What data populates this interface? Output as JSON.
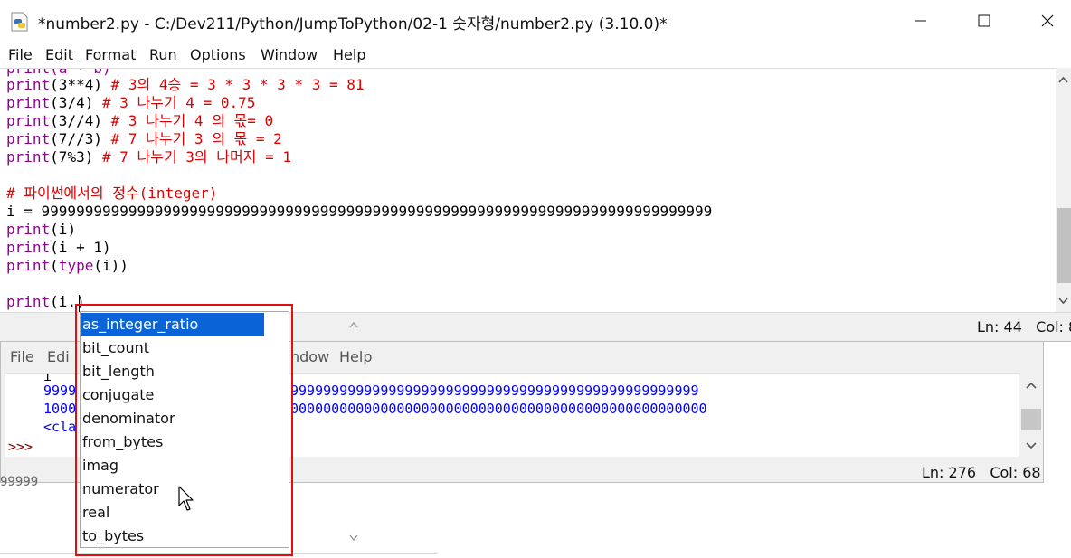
{
  "editor": {
    "title": "*number2.py - C:/Dev211/Python/JumpToPython/02-1 숫자형/number2.py (3.10.0)*",
    "menu": [
      "File",
      "Edit",
      "Format",
      "Run",
      "Options",
      "Window",
      "Help"
    ],
    "code": {
      "partial_top": "print(a * b)",
      "line1_call": "print",
      "line1_args": "(3**4)",
      "line1_comment": " # 3의 4승 = 3 * 3 * 3 * 3 = 81",
      "line2_call": "print",
      "line2_args": "(3/4)",
      "line2_comment": " # 3 나누기 4 = 0.75",
      "line3_call": "print",
      "line3_args": "(3//4)",
      "line3_comment": " # 3 나누기 4 의 몫= 0",
      "line4_call": "print",
      "line4_args": "(7//3)",
      "line4_comment": " # 7 나누기 3 의 몫 = 2",
      "line5_call": "print",
      "line5_args": "(7%3)",
      "line5_comment": " # 7 나누기 3의 나머지 = 1",
      "line6_comment": "# 파이썬에서의 정수(integer)",
      "line7": "i = 99999999999999999999999999999999999999999999999999999999999999999999999999999",
      "line8_call": "print",
      "line8_args": "(i)",
      "line9_call": "print",
      "line9_args": "(i + 1)",
      "line10_call": "print",
      "line10_args_a": "(",
      "line10_type": "type",
      "line10_args_b": "(i))",
      "line11_call": "print",
      "line11_args": "(i.)"
    },
    "status": "Ln: 44   Col: 8"
  },
  "shell": {
    "menu": [
      "File",
      "Edit",
      "",
      "",
      "",
      "Window",
      "Help"
    ],
    "menu_visible": [
      "File",
      "Edi",
      "ndow",
      "Help"
    ],
    "line1": "i",
    "line2": "9999",
    "line2_tail": "99999999999999999999999999999999999999999999999999",
    "line3": "1000",
    "line3_tail": "000000000000000000000000000000000000000000000000000",
    "line4": "<cla",
    "prompt": ">>>",
    "status": "Ln: 276   Col: 68"
  },
  "background_fragment": "99999",
  "completion": {
    "items": [
      "as_integer_ratio",
      "bit_count",
      "bit_length",
      "conjugate",
      "denominator",
      "from_bytes",
      "imag",
      "numerator",
      "real",
      "to_bytes"
    ],
    "selected_index": 0
  },
  "colors": {
    "keyword": "#900090",
    "comment": "#dd0000",
    "output": "#0000ff",
    "selection": "#0a64d8",
    "highlight_box": "#e01010"
  }
}
